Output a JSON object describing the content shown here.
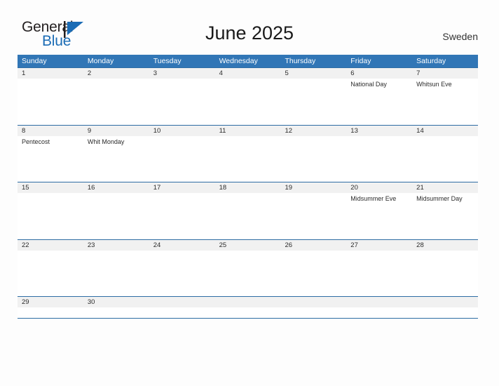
{
  "brand": {
    "name_part1": "General",
    "name_part2": "Blue",
    "mark": "triangle-icon",
    "color_dark": "#231f20",
    "color_blue": "#1b6cb5"
  },
  "header": {
    "title": "June 2025",
    "region": "Sweden"
  },
  "theme": {
    "header_blue": "#3176b6",
    "row_line_blue": "#2e6da4",
    "number_band_gray": "#f1f1f1",
    "page_background": "#fdfdfd"
  },
  "calendar": {
    "weekdays": [
      "Sunday",
      "Monday",
      "Tuesday",
      "Wednesday",
      "Thursday",
      "Friday",
      "Saturday"
    ],
    "weeks": [
      {
        "days": [
          {
            "number": "1",
            "event": ""
          },
          {
            "number": "2",
            "event": ""
          },
          {
            "number": "3",
            "event": ""
          },
          {
            "number": "4",
            "event": ""
          },
          {
            "number": "5",
            "event": ""
          },
          {
            "number": "6",
            "event": "National Day"
          },
          {
            "number": "7",
            "event": "Whitsun Eve"
          }
        ]
      },
      {
        "days": [
          {
            "number": "8",
            "event": "Pentecost"
          },
          {
            "number": "9",
            "event": "Whit Monday"
          },
          {
            "number": "10",
            "event": ""
          },
          {
            "number": "11",
            "event": ""
          },
          {
            "number": "12",
            "event": ""
          },
          {
            "number": "13",
            "event": ""
          },
          {
            "number": "14",
            "event": ""
          }
        ]
      },
      {
        "days": [
          {
            "number": "15",
            "event": ""
          },
          {
            "number": "16",
            "event": ""
          },
          {
            "number": "17",
            "event": ""
          },
          {
            "number": "18",
            "event": ""
          },
          {
            "number": "19",
            "event": ""
          },
          {
            "number": "20",
            "event": "Midsummer Eve"
          },
          {
            "number": "21",
            "event": "Midsummer Day"
          }
        ]
      },
      {
        "days": [
          {
            "number": "22",
            "event": ""
          },
          {
            "number": "23",
            "event": ""
          },
          {
            "number": "24",
            "event": ""
          },
          {
            "number": "25",
            "event": ""
          },
          {
            "number": "26",
            "event": ""
          },
          {
            "number": "27",
            "event": ""
          },
          {
            "number": "28",
            "event": ""
          }
        ]
      },
      {
        "days": [
          {
            "number": "29",
            "event": ""
          },
          {
            "number": "30",
            "event": ""
          },
          {
            "number": "",
            "event": ""
          },
          {
            "number": "",
            "event": ""
          },
          {
            "number": "",
            "event": ""
          },
          {
            "number": "",
            "event": ""
          },
          {
            "number": "",
            "event": ""
          }
        ]
      }
    ]
  }
}
